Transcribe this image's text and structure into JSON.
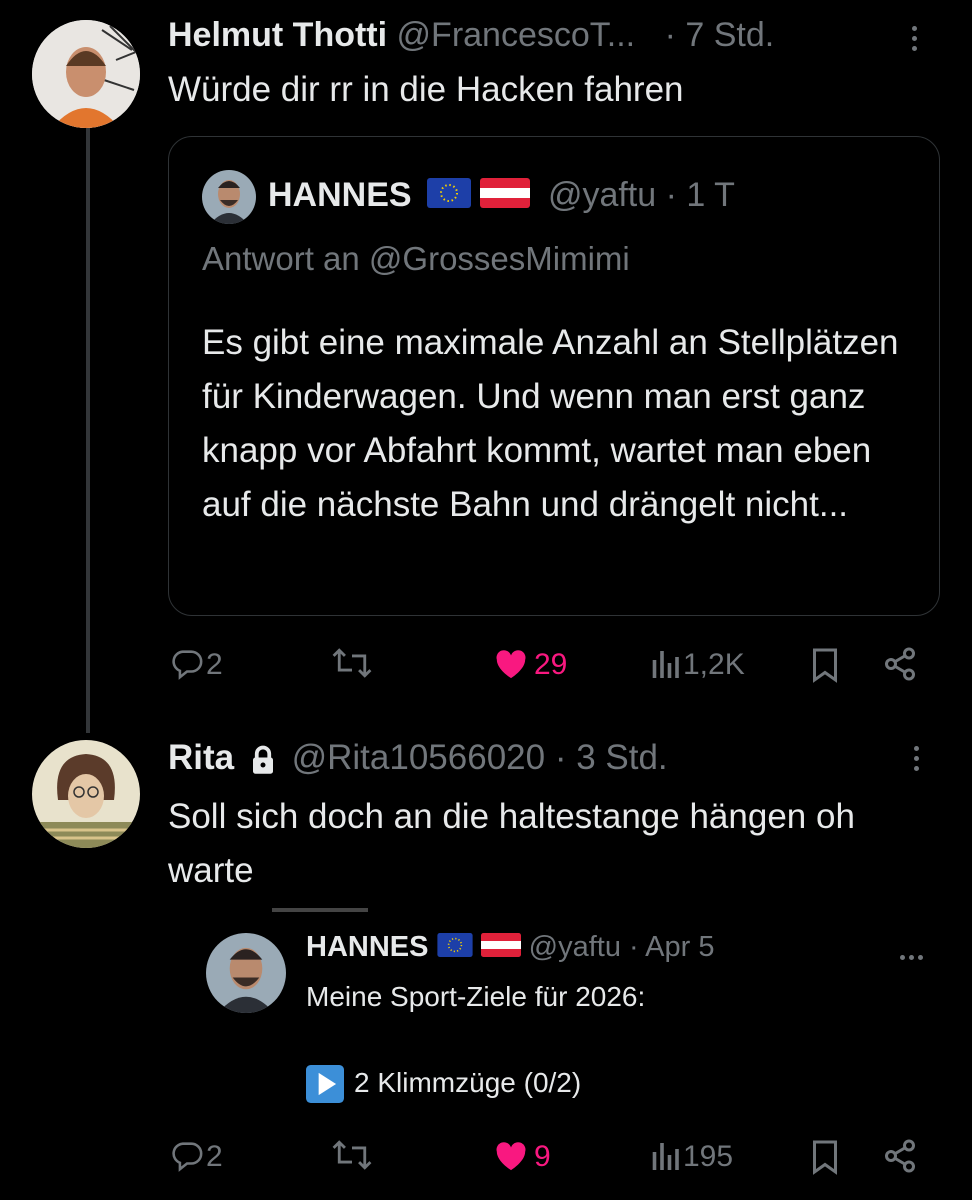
{
  "colors": {
    "background": "#000000",
    "text": "#e7e9ea",
    "muted": "#71767b",
    "like": "#f91880",
    "border": "#2f3336"
  },
  "tweet1": {
    "author_name": "Helmut Thotti",
    "author_handle": "@FrancescoT...",
    "time": "· 7 Std.",
    "text": "Würde dir rr in die Hacken fahren",
    "quote": {
      "author_name": "HANNES",
      "author_handle": "@yaftu",
      "time": "· 1 T",
      "reply_to": "Antwort an @GrossesMimimi",
      "text": "Es gibt eine maximale Anzahl an Stellplätzen für Kinderwagen. Und wenn man erst ganz knapp vor Abfahrt kommt, wartet man eben auf die nächste Bahn und drängelt nicht..."
    },
    "actions": {
      "replies": "2",
      "retweets": "",
      "likes": "29",
      "views": "1,2K"
    }
  },
  "tweet2": {
    "author_name": "Rita",
    "author_handle": "@Rita10566020",
    "time": "· 3 Std.",
    "text": "Soll sich doch an die haltestange hängen oh warte",
    "embedded": {
      "author_name": "HANNES",
      "author_handle": "@yaftu",
      "time": "· Apr 5",
      "line1": "Meine Sport-Ziele für 2026:",
      "line2": "2 Klimmzüge (0/2)"
    },
    "actions": {
      "replies": "2",
      "retweets": "",
      "likes": "9",
      "views": "195"
    }
  },
  "icons": [
    "reply-icon",
    "retweet-icon",
    "like-icon",
    "views-icon",
    "bookmark-icon",
    "share-icon",
    "lock-icon",
    "more-icon",
    "play-icon"
  ]
}
